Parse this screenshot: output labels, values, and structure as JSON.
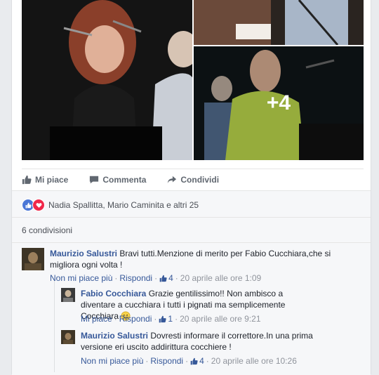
{
  "photos": {
    "more_count": "+4"
  },
  "actions": {
    "like": "Mi piace",
    "comment": "Commenta",
    "share": "Condividi"
  },
  "reactions": {
    "names": "Nadia Spallitta, Mario Caminita e altri 25"
  },
  "shares": {
    "label": "6 condivisioni"
  },
  "comments": [
    {
      "name": "Maurizio Salustri",
      "text": "Bravi tutti.Menzione di merito per Fabio Cucchiara,che si migliora ogni volta !",
      "unlike": "Non mi piace più",
      "reply": "Rispondi",
      "likes": "4",
      "time": "20 aprile alle ore 1:09"
    }
  ],
  "replies": [
    {
      "name": "Fabio Cocchiara",
      "text": "Grazie gentilissimo!! Non ambisco a diventare a cucchiara i tutti i pignati ma semplicemente Cocchiara",
      "like": "Mi piace",
      "reply": "Rispondi",
      "likes": "1",
      "time": "20 aprile alle ore 9:21"
    },
    {
      "name": "Maurizio Salustri",
      "text": "Dovresti informare il correttore.In una prima versione eri uscito addirittura cocchiere !",
      "unlike": "Non mi piace più",
      "reply": "Rispondi",
      "likes": "4",
      "time": "20 aprile alle ore 10:26"
    }
  ],
  "colors": {
    "link": "#365899",
    "like_blue": "#4a76d6",
    "love_red": "#f0284a",
    "meta_gray": "#90949c"
  }
}
